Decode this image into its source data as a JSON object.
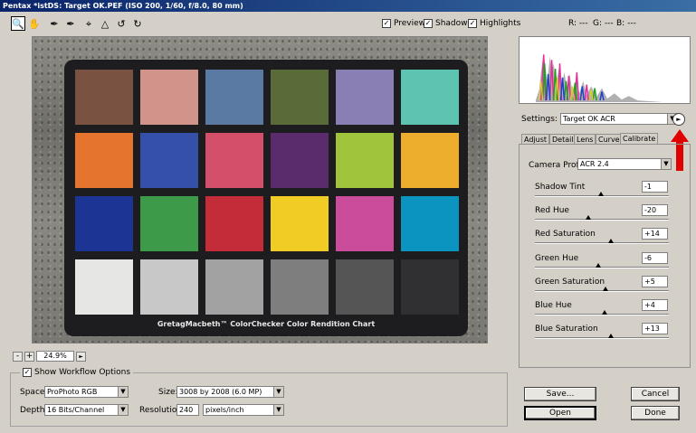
{
  "window": {
    "title": "Pentax *istDS: Target OK.PEF (ISO 200, 1/60, f/8.0, 80 mm)"
  },
  "toolbar": {
    "tools": [
      "zoom-icon",
      "hand-icon",
      "white-balance-icon",
      "color-sampler-icon",
      "crop-icon",
      "straighten-icon",
      "rotate-left-icon",
      "rotate-right-icon"
    ]
  },
  "options": {
    "preview": {
      "label": "Preview",
      "checked": true
    },
    "shadows": {
      "label": "Shadows",
      "checked": true
    },
    "highlights": {
      "label": "Highlights",
      "checked": true
    }
  },
  "readout": {
    "r": "R: ---",
    "g": "G: ---",
    "b": "B: ---"
  },
  "chart_caption": "GretagMacbeth™ ColorChecker Color Rendition Chart",
  "colorchecker": {
    "rows": [
      [
        "#7a5242",
        "#d1948a",
        "#5a7aa4",
        "#586b38",
        "#8a7fb4",
        "#5cc4b0"
      ],
      [
        "#e4742e",
        "#3450a8",
        "#d4506a",
        "#5a2c6c",
        "#a0c43c",
        "#ecae2c"
      ],
      [
        "#1c3494",
        "#3c9a48",
        "#c42c3a",
        "#f0cc24",
        "#cc4c9c",
        "#0c94c0"
      ],
      [
        "#e6e6e4",
        "#c8c8c8",
        "#a2a2a2",
        "#7e7e7e",
        "#555555",
        "#303032"
      ]
    ]
  },
  "zoom": {
    "minus": "-",
    "plus": "+",
    "level": "24.9%",
    "arrow": "►"
  },
  "workflow": {
    "show_label": "Show Workflow Options",
    "checked": true,
    "space_label": "Space:",
    "space_value": "ProPhoto RGB",
    "depth_label": "Depth:",
    "depth_value": "16 Bits/Channel",
    "size_label": "Size:",
    "size_value": "3008 by 2008 (6.0 MP)",
    "resolution_label": "Resolution:",
    "resolution_value": "240",
    "resolution_unit": "pixels/inch"
  },
  "settings": {
    "label": "Settings:",
    "value": "Target OK ACR",
    "menu_icon": "►"
  },
  "tabs": [
    "Adjust",
    "Detail",
    "Lens",
    "Curve",
    "Calibrate"
  ],
  "active_tab": "Calibrate",
  "calibrate": {
    "camera_profile_label": "Camera Profile:",
    "camera_profile_value": "ACR 2.4",
    "sliders": [
      {
        "label": "Shadow Tint",
        "value": "-1",
        "min": -100,
        "max": 100,
        "level": -1
      },
      {
        "label": "Red Hue",
        "value": "-20",
        "min": -100,
        "max": 100,
        "level": -20
      },
      {
        "label": "Red Saturation",
        "value": "+14",
        "min": -100,
        "max": 100,
        "level": 14
      },
      {
        "label": "Green Hue",
        "value": "-6",
        "min": -100,
        "max": 100,
        "level": -6
      },
      {
        "label": "Green Saturation",
        "value": "+5",
        "min": -100,
        "max": 100,
        "level": 5
      },
      {
        "label": "Blue Hue",
        "value": "+4",
        "min": -100,
        "max": 100,
        "level": 4
      },
      {
        "label": "Blue Saturation",
        "value": "+13",
        "min": -100,
        "max": 100,
        "level": 13
      }
    ]
  },
  "buttons": {
    "save": "Save...",
    "cancel": "Cancel",
    "open": "Open",
    "done": "Done"
  },
  "colors": {
    "accent_arrow": "#e00000",
    "title_bar": "#0a246a"
  }
}
